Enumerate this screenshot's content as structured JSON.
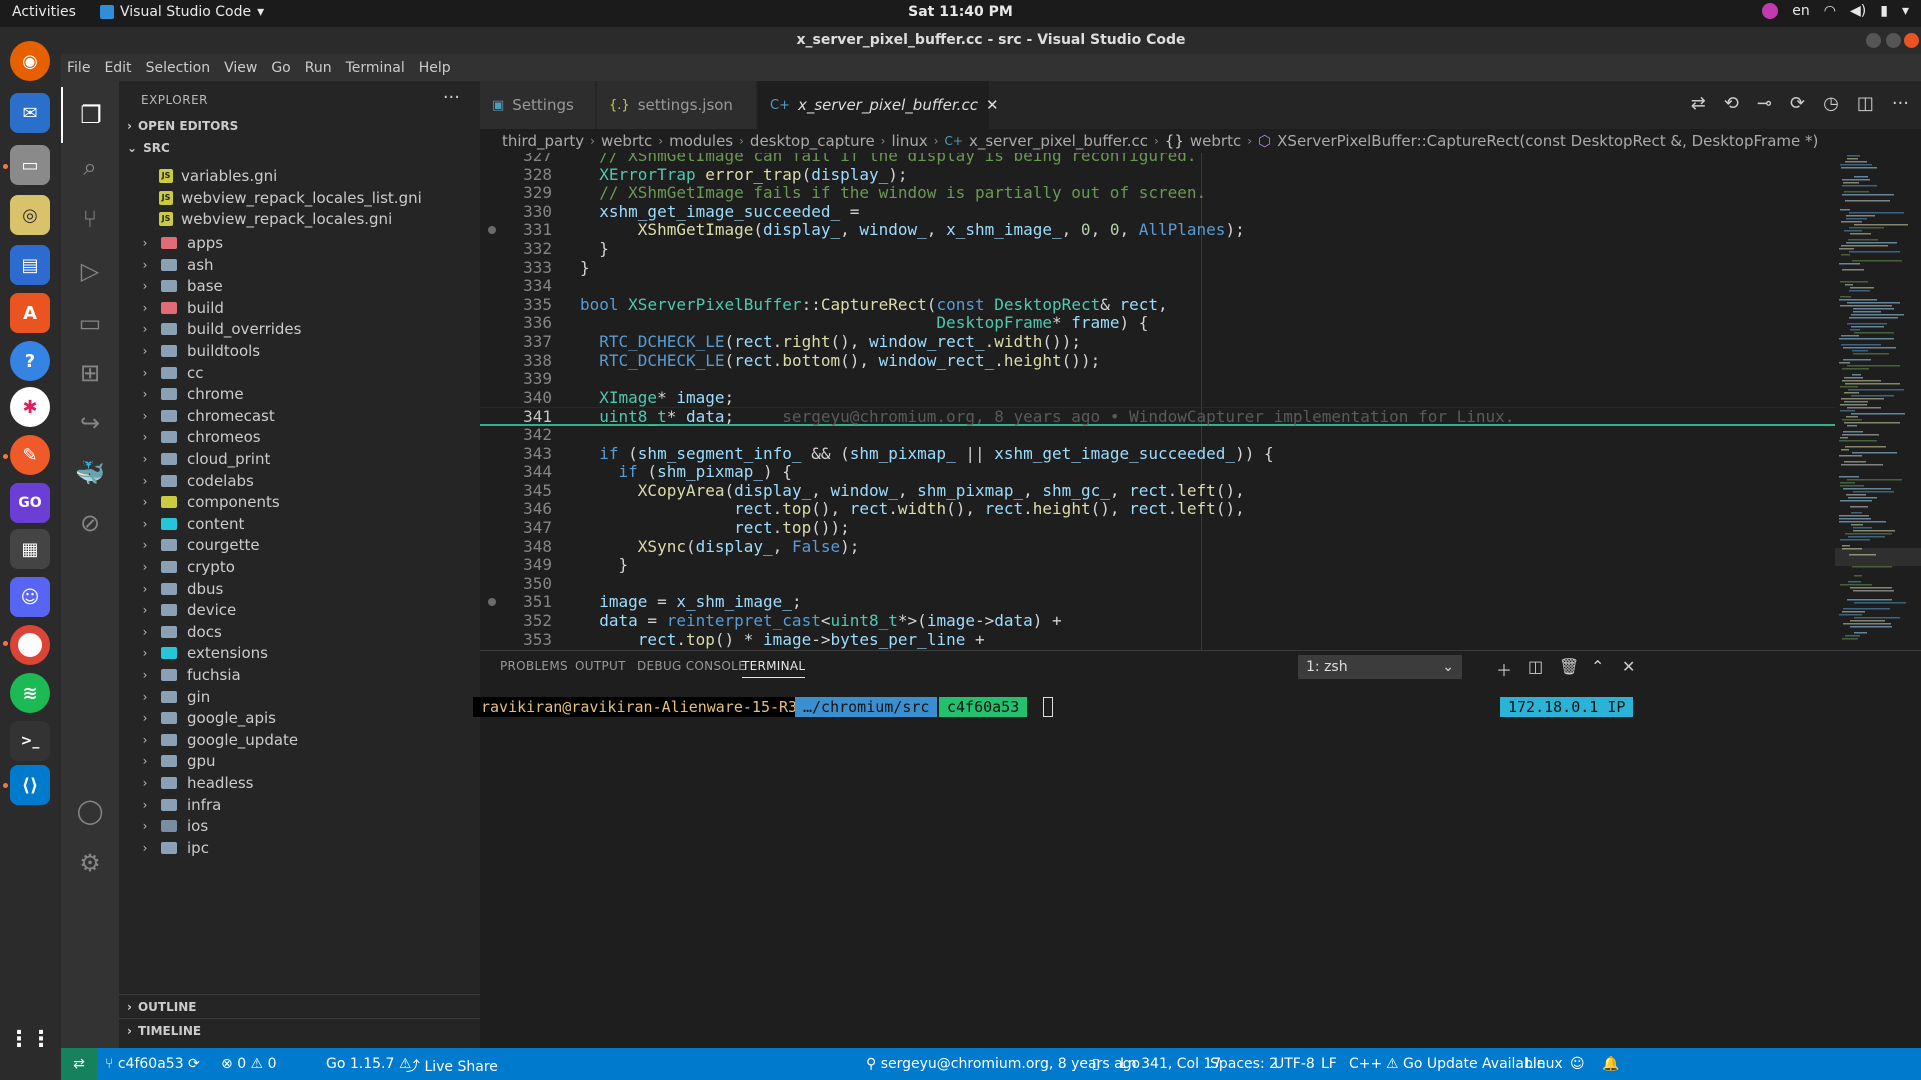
{
  "system": {
    "activities": "Activities",
    "app_name": "Visual Studio Code",
    "clock": "Sat 11:40 PM",
    "lang": "en"
  },
  "window": {
    "title": "x_server_pixel_buffer.cc - src - Visual Studio Code"
  },
  "menu": [
    "File",
    "Edit",
    "Selection",
    "View",
    "Go",
    "Run",
    "Terminal",
    "Help"
  ],
  "explorer": {
    "title": "EXPLORER",
    "open_editors": "OPEN EDITORS",
    "root": "SRC",
    "files": [
      "variables.gni",
      "webview_repack_locales_list.gni",
      "webview_repack_locales.gni"
    ],
    "folders": [
      "apps",
      "ash",
      "base",
      "build",
      "build_overrides",
      "buildtools",
      "cc",
      "chrome",
      "chromecast",
      "chromeos",
      "cloud_print",
      "codelabs",
      "components",
      "content",
      "courgette",
      "crypto",
      "dbus",
      "device",
      "docs",
      "extensions",
      "fuchsia",
      "gin",
      "google_apis",
      "google_update",
      "gpu",
      "headless",
      "infra",
      "ios",
      "ipc"
    ],
    "outline": "OUTLINE",
    "timeline": "TIMELINE"
  },
  "tabs": [
    {
      "label": "Settings",
      "icon": "settings-file-icon"
    },
    {
      "label": "settings.json",
      "icon": "json-file-icon"
    },
    {
      "label": "x_server_pixel_buffer.cc",
      "icon": "cpp-file-icon"
    }
  ],
  "breadcrumb": [
    "third_party",
    "webrtc",
    "modules",
    "desktop_capture",
    "linux",
    "x_server_pixel_buffer.cc",
    "webrtc",
    "XServerPixelBuffer::CaptureRect(const DesktopRect &, DesktopFrame *)"
  ],
  "code": {
    "line_numbers": [
      "327",
      "328",
      "329",
      "330",
      "331",
      "332",
      "333",
      "334",
      "335",
      "336",
      "337",
      "338",
      "339",
      "340",
      "341",
      "342",
      "343",
      "344",
      "345",
      "346",
      "347",
      "348",
      "349",
      "350",
      "351",
      "352",
      "353"
    ],
    "current_line": "341",
    "blame": "sergeyu@chromium.org, 8 years ago • WindowCapturer implementation for Linux."
  },
  "panel": {
    "tabs": [
      "PROBLEMS",
      "OUTPUT",
      "DEBUG CONSOLE",
      "TERMINAL"
    ],
    "terminal_select": "1: zsh",
    "prompt_user": "ravikiran@ravikiran-Alienware-15-R3",
    "prompt_dir": "…/chromium/src",
    "prompt_git": "c4f60a53",
    "prompt_ip": "172.18.0.1 IP"
  },
  "statusbar": {
    "branch": "c4f60a53",
    "errors": "0",
    "warnings": "0",
    "go_version": "Go 1.15.7",
    "live_share": "Live Share",
    "blame": "sergeyu@chromium.org, 8 years ago",
    "cursor": "Ln 341, Col 17",
    "spaces": "Spaces: 2",
    "encoding": "UTF-8",
    "eol": "LF",
    "language": "C++",
    "update": "Go Update Available",
    "os": "Linux"
  }
}
